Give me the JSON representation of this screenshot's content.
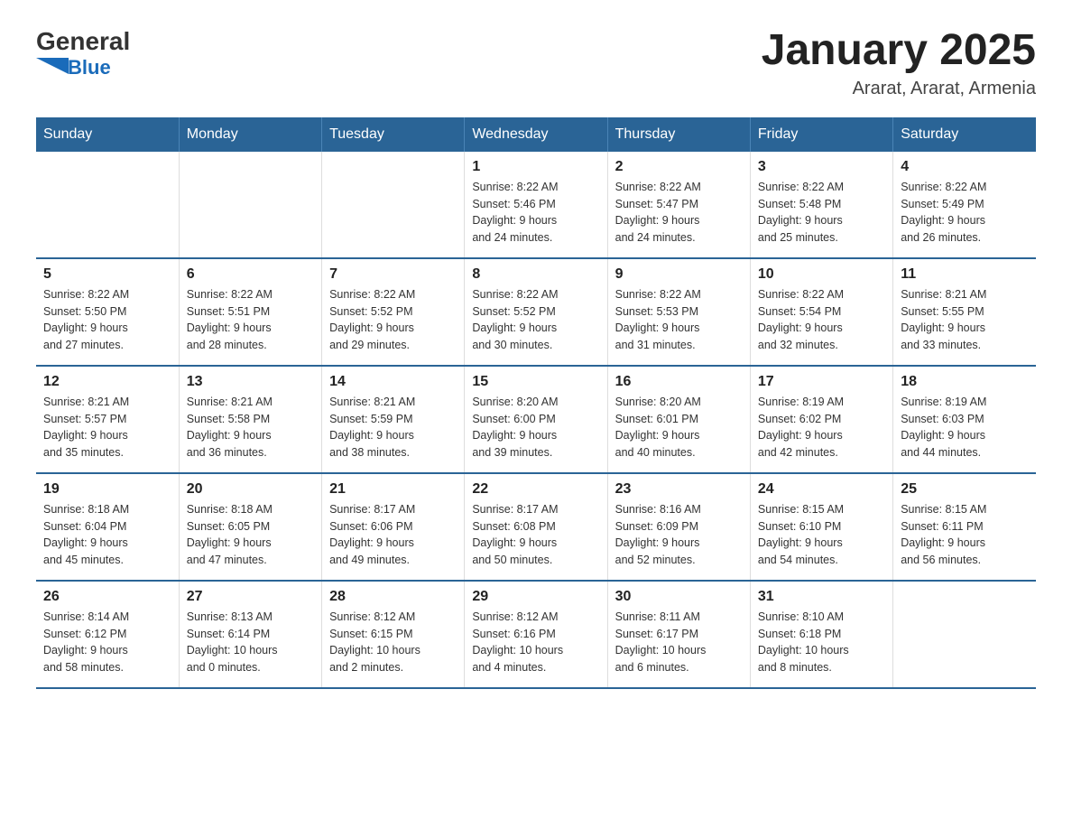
{
  "header": {
    "logo_general": "General",
    "logo_blue": "Blue",
    "month": "January 2025",
    "location": "Ararat, Ararat, Armenia"
  },
  "days_of_week": [
    "Sunday",
    "Monday",
    "Tuesday",
    "Wednesday",
    "Thursday",
    "Friday",
    "Saturday"
  ],
  "weeks": [
    [
      {
        "day": "",
        "info": ""
      },
      {
        "day": "",
        "info": ""
      },
      {
        "day": "",
        "info": ""
      },
      {
        "day": "1",
        "info": "Sunrise: 8:22 AM\nSunset: 5:46 PM\nDaylight: 9 hours\nand 24 minutes."
      },
      {
        "day": "2",
        "info": "Sunrise: 8:22 AM\nSunset: 5:47 PM\nDaylight: 9 hours\nand 24 minutes."
      },
      {
        "day": "3",
        "info": "Sunrise: 8:22 AM\nSunset: 5:48 PM\nDaylight: 9 hours\nand 25 minutes."
      },
      {
        "day": "4",
        "info": "Sunrise: 8:22 AM\nSunset: 5:49 PM\nDaylight: 9 hours\nand 26 minutes."
      }
    ],
    [
      {
        "day": "5",
        "info": "Sunrise: 8:22 AM\nSunset: 5:50 PM\nDaylight: 9 hours\nand 27 minutes."
      },
      {
        "day": "6",
        "info": "Sunrise: 8:22 AM\nSunset: 5:51 PM\nDaylight: 9 hours\nand 28 minutes."
      },
      {
        "day": "7",
        "info": "Sunrise: 8:22 AM\nSunset: 5:52 PM\nDaylight: 9 hours\nand 29 minutes."
      },
      {
        "day": "8",
        "info": "Sunrise: 8:22 AM\nSunset: 5:52 PM\nDaylight: 9 hours\nand 30 minutes."
      },
      {
        "day": "9",
        "info": "Sunrise: 8:22 AM\nSunset: 5:53 PM\nDaylight: 9 hours\nand 31 minutes."
      },
      {
        "day": "10",
        "info": "Sunrise: 8:22 AM\nSunset: 5:54 PM\nDaylight: 9 hours\nand 32 minutes."
      },
      {
        "day": "11",
        "info": "Sunrise: 8:21 AM\nSunset: 5:55 PM\nDaylight: 9 hours\nand 33 minutes."
      }
    ],
    [
      {
        "day": "12",
        "info": "Sunrise: 8:21 AM\nSunset: 5:57 PM\nDaylight: 9 hours\nand 35 minutes."
      },
      {
        "day": "13",
        "info": "Sunrise: 8:21 AM\nSunset: 5:58 PM\nDaylight: 9 hours\nand 36 minutes."
      },
      {
        "day": "14",
        "info": "Sunrise: 8:21 AM\nSunset: 5:59 PM\nDaylight: 9 hours\nand 38 minutes."
      },
      {
        "day": "15",
        "info": "Sunrise: 8:20 AM\nSunset: 6:00 PM\nDaylight: 9 hours\nand 39 minutes."
      },
      {
        "day": "16",
        "info": "Sunrise: 8:20 AM\nSunset: 6:01 PM\nDaylight: 9 hours\nand 40 minutes."
      },
      {
        "day": "17",
        "info": "Sunrise: 8:19 AM\nSunset: 6:02 PM\nDaylight: 9 hours\nand 42 minutes."
      },
      {
        "day": "18",
        "info": "Sunrise: 8:19 AM\nSunset: 6:03 PM\nDaylight: 9 hours\nand 44 minutes."
      }
    ],
    [
      {
        "day": "19",
        "info": "Sunrise: 8:18 AM\nSunset: 6:04 PM\nDaylight: 9 hours\nand 45 minutes."
      },
      {
        "day": "20",
        "info": "Sunrise: 8:18 AM\nSunset: 6:05 PM\nDaylight: 9 hours\nand 47 minutes."
      },
      {
        "day": "21",
        "info": "Sunrise: 8:17 AM\nSunset: 6:06 PM\nDaylight: 9 hours\nand 49 minutes."
      },
      {
        "day": "22",
        "info": "Sunrise: 8:17 AM\nSunset: 6:08 PM\nDaylight: 9 hours\nand 50 minutes."
      },
      {
        "day": "23",
        "info": "Sunrise: 8:16 AM\nSunset: 6:09 PM\nDaylight: 9 hours\nand 52 minutes."
      },
      {
        "day": "24",
        "info": "Sunrise: 8:15 AM\nSunset: 6:10 PM\nDaylight: 9 hours\nand 54 minutes."
      },
      {
        "day": "25",
        "info": "Sunrise: 8:15 AM\nSunset: 6:11 PM\nDaylight: 9 hours\nand 56 minutes."
      }
    ],
    [
      {
        "day": "26",
        "info": "Sunrise: 8:14 AM\nSunset: 6:12 PM\nDaylight: 9 hours\nand 58 minutes."
      },
      {
        "day": "27",
        "info": "Sunrise: 8:13 AM\nSunset: 6:14 PM\nDaylight: 10 hours\nand 0 minutes."
      },
      {
        "day": "28",
        "info": "Sunrise: 8:12 AM\nSunset: 6:15 PM\nDaylight: 10 hours\nand 2 minutes."
      },
      {
        "day": "29",
        "info": "Sunrise: 8:12 AM\nSunset: 6:16 PM\nDaylight: 10 hours\nand 4 minutes."
      },
      {
        "day": "30",
        "info": "Sunrise: 8:11 AM\nSunset: 6:17 PM\nDaylight: 10 hours\nand 6 minutes."
      },
      {
        "day": "31",
        "info": "Sunrise: 8:10 AM\nSunset: 6:18 PM\nDaylight: 10 hours\nand 8 minutes."
      },
      {
        "day": "",
        "info": ""
      }
    ]
  ]
}
